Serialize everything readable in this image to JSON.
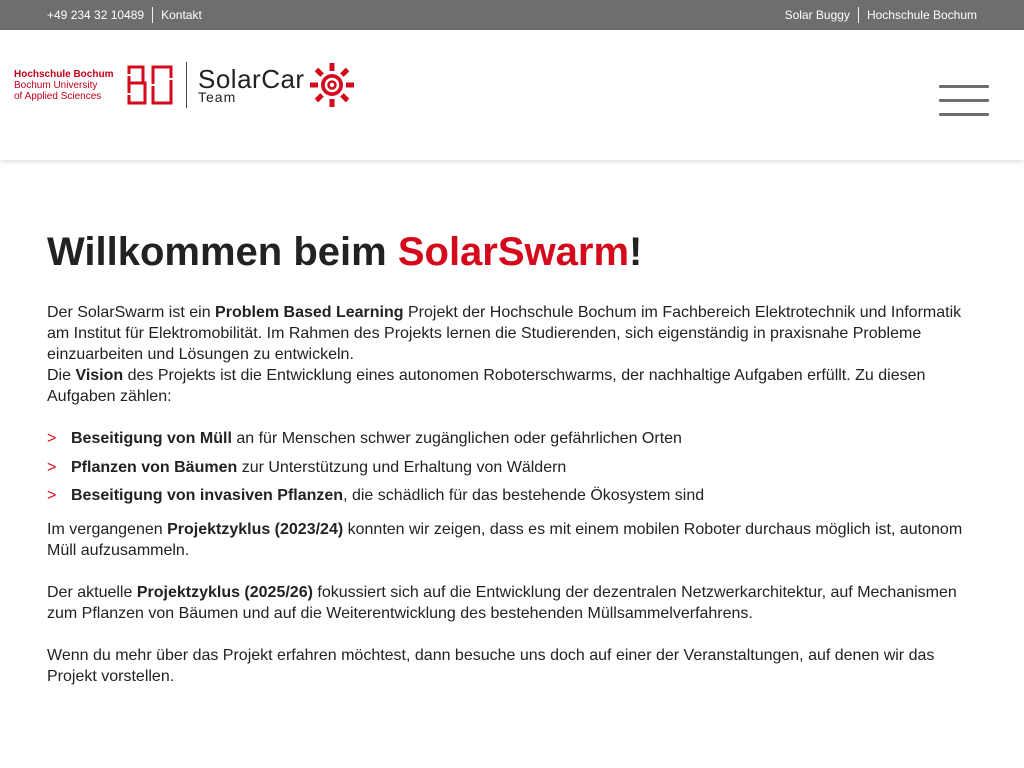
{
  "topbar": {
    "phone": "+49 234 32 10489",
    "contact": "Kontakt",
    "link_buggy": "Solar Buggy",
    "link_hsb": "Hochschule Bochum"
  },
  "logo": {
    "hsb_line1": "Hochschule Bochum",
    "hsb_line2": "Bochum University",
    "hsb_line3": "of Applied Sciences",
    "solarcar_line1": "SolarCar",
    "solarcar_line2": "Team"
  },
  "colors": {
    "accent": "#d40a1c",
    "topbar": "#6d6e70"
  },
  "content": {
    "title_pre": "Willkommen beim ",
    "title_accent": "SolarSwarm",
    "title_post": "!",
    "p1_a": "Der SolarSwarm ist ein ",
    "p1_b": "Problem Based Learning",
    "p1_c": " Projekt der Hochschule Bochum im Fachbereich Elektrotechnik und Informatik am Institut für Elektromobilität. Im Rahmen des Projekts lernen die Studierenden, sich eigenständig in praxisnahe Probleme einzuarbeiten und Lösungen zu entwickeln.",
    "p2_a": "Die ",
    "p2_b": "Vision",
    "p2_c": " des Projekts ist die Entwicklung eines autonomen Roboterschwarms, der nachhaltige Aufgaben erfüllt. Zu diesen Aufgaben zählen:",
    "tasks": [
      {
        "bold": "Beseitigung von Müll",
        "rest": " an für Menschen schwer zugänglichen oder gefährlichen Orten"
      },
      {
        "bold": "Pflanzen von Bäumen",
        "rest": " zur Unterstützung und Erhaltung von Wäldern"
      },
      {
        "bold": "Beseitigung von invasiven Pflanzen",
        "rest": ", die schädlich für das bestehende Ökosystem sind"
      }
    ],
    "bullet": ">",
    "p3_a": "Im vergangenen ",
    "p3_b": "Projektzyklus (2023/24)",
    "p3_c": " konnten wir zeigen, dass es mit einem mobilen Roboter durchaus möglich ist, autonom Müll aufzusammeln.",
    "p4_a": "Der aktuelle ",
    "p4_b": "Projektzyklus (2025/26)",
    "p4_c": " fokussiert sich auf die Entwicklung der dezentralen Netzwerkarchitektur, auf Mechanismen zum Pflanzen von Bäumen und auf die Weiterentwicklung des bestehenden Müllsammelverfahrens.",
    "p5": "Wenn du mehr über das Projekt erfahren möchtest, dann besuche uns doch auf einer der Veranstaltungen, auf denen wir das Projekt vorstellen."
  }
}
